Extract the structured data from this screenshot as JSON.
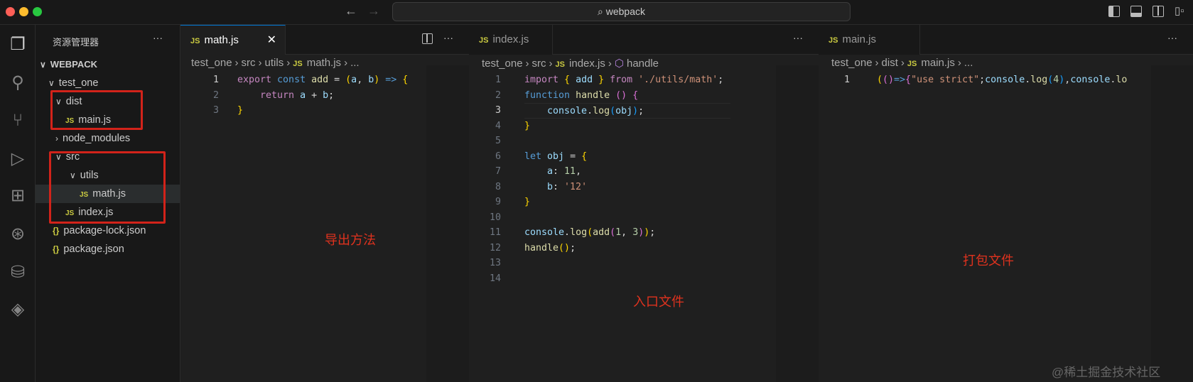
{
  "window": {
    "search_text": "webpack"
  },
  "sidebar": {
    "title": "资源管理器",
    "more": "···",
    "root": "WEBPACK",
    "items": [
      {
        "label": "test_one",
        "kind": "folder-open",
        "depth": 1
      },
      {
        "label": "dist",
        "kind": "folder-open",
        "depth": 2
      },
      {
        "label": "main.js",
        "kind": "js",
        "depth": 2
      },
      {
        "label": "node_modules",
        "kind": "folder-closed",
        "depth": 2
      },
      {
        "label": "src",
        "kind": "folder-open",
        "depth": 2
      },
      {
        "label": "utils",
        "kind": "folder-open",
        "depth": 3
      },
      {
        "label": "math.js",
        "kind": "js",
        "depth": 3,
        "selected": true
      },
      {
        "label": "index.js",
        "kind": "js",
        "depth": 2
      },
      {
        "label": "package-lock.json",
        "kind": "json",
        "depth": 1
      },
      {
        "label": "package.json",
        "kind": "json",
        "depth": 1
      }
    ]
  },
  "editors": [
    {
      "tab": "math.js",
      "icon": "JS",
      "more": "···",
      "breadcrumb": [
        "test_one",
        "src",
        "utils",
        "math.js",
        "..."
      ],
      "active_line": 0,
      "lines": [
        [
          [
            "export ",
            "c-kw"
          ],
          [
            "const ",
            "c-st"
          ],
          [
            "add",
            "c-fn"
          ],
          [
            " = ",
            "c-p"
          ],
          [
            "(",
            "c-b1"
          ],
          [
            "a",
            "c-var"
          ],
          [
            ", ",
            "c-p"
          ],
          [
            "b",
            "c-var"
          ],
          [
            ")",
            "c-b1"
          ],
          [
            " => ",
            "c-st"
          ],
          [
            "{",
            "c-b1"
          ]
        ],
        [
          [
            "    return ",
            "c-kw"
          ],
          [
            "a",
            "c-var"
          ],
          [
            " + ",
            "c-p"
          ],
          [
            "b",
            "c-var"
          ],
          [
            ";",
            "c-p"
          ]
        ],
        [
          [
            "}",
            "c-b1"
          ]
        ]
      ]
    },
    {
      "tab": "index.js",
      "icon": "JS",
      "more": "···",
      "breadcrumb": [
        "test_one",
        "src",
        "index.js",
        "handle"
      ],
      "active_line": 3,
      "lines": [
        [
          [
            "import ",
            "c-kw"
          ],
          [
            "{ ",
            "c-b1"
          ],
          [
            "add",
            "c-var"
          ],
          [
            " } ",
            "c-b1"
          ],
          [
            "from ",
            "c-kw"
          ],
          [
            "'./utils/math'",
            "c-str"
          ],
          [
            ";",
            "c-p"
          ]
        ],
        [
          [
            "function ",
            "c-st"
          ],
          [
            "handle ",
            "c-fn"
          ],
          [
            "()",
            "c-b2"
          ],
          [
            " {",
            "c-b2"
          ]
        ],
        [
          [
            "    console",
            "c-var"
          ],
          [
            ".",
            "c-p"
          ],
          [
            "log",
            "c-fn"
          ],
          [
            "(",
            "c-b3"
          ],
          [
            "obj",
            "c-var"
          ],
          [
            ")",
            "c-b3"
          ],
          [
            ";",
            "c-p"
          ]
        ],
        [
          [
            "}",
            "c-b1"
          ]
        ],
        [],
        [
          [
            "let ",
            "c-st"
          ],
          [
            "obj",
            "c-var"
          ],
          [
            " = ",
            "c-p"
          ],
          [
            "{",
            "c-b1"
          ]
        ],
        [
          [
            "    a",
            "c-prop"
          ],
          [
            ": ",
            "c-p"
          ],
          [
            "11",
            "c-num"
          ],
          [
            ",",
            "c-p"
          ]
        ],
        [
          [
            "    b",
            "c-prop"
          ],
          [
            ": ",
            "c-p"
          ],
          [
            "'12'",
            "c-str"
          ]
        ],
        [
          [
            "}",
            "c-b1"
          ]
        ],
        [],
        [
          [
            "console",
            "c-var"
          ],
          [
            ".",
            "c-p"
          ],
          [
            "log",
            "c-fn"
          ],
          [
            "(",
            "c-b1"
          ],
          [
            "add",
            "c-fn"
          ],
          [
            "(",
            "c-b2"
          ],
          [
            "1",
            "c-num"
          ],
          [
            ", ",
            "c-p"
          ],
          [
            "3",
            "c-num"
          ],
          [
            ")",
            "c-b2"
          ],
          [
            ")",
            "c-b1"
          ],
          [
            ";",
            "c-p"
          ]
        ],
        [
          [
            "handle",
            "c-fn"
          ],
          [
            "()",
            "c-b1"
          ],
          [
            ";",
            "c-p"
          ]
        ],
        [],
        []
      ]
    },
    {
      "tab": "main.js",
      "icon": "JS",
      "more": "···",
      "breadcrumb": [
        "test_one",
        "dist",
        "main.js",
        "..."
      ],
      "active_line": 0,
      "lines": [
        [
          [
            "(",
            "c-b1"
          ],
          [
            "()",
            "c-b2"
          ],
          [
            "=>",
            "c-st"
          ],
          [
            "{",
            "c-b2"
          ],
          [
            "\"use strict\"",
            "c-str"
          ],
          [
            ";",
            "c-p"
          ],
          [
            "console",
            "c-var"
          ],
          [
            ".",
            "c-p"
          ],
          [
            "log",
            "c-fn"
          ],
          [
            "(",
            "c-b3"
          ],
          [
            "4",
            "c-num"
          ],
          [
            ")",
            "c-b3"
          ],
          [
            ",",
            "c-p"
          ],
          [
            "console",
            "c-var"
          ],
          [
            ".",
            "c-p"
          ],
          [
            "lo",
            "c-fn"
          ]
        ]
      ]
    }
  ],
  "annotations": {
    "export": "导出方法",
    "entry": "入口文件",
    "bundle": "打包文件"
  },
  "watermark": "@稀土掘金技术社区"
}
